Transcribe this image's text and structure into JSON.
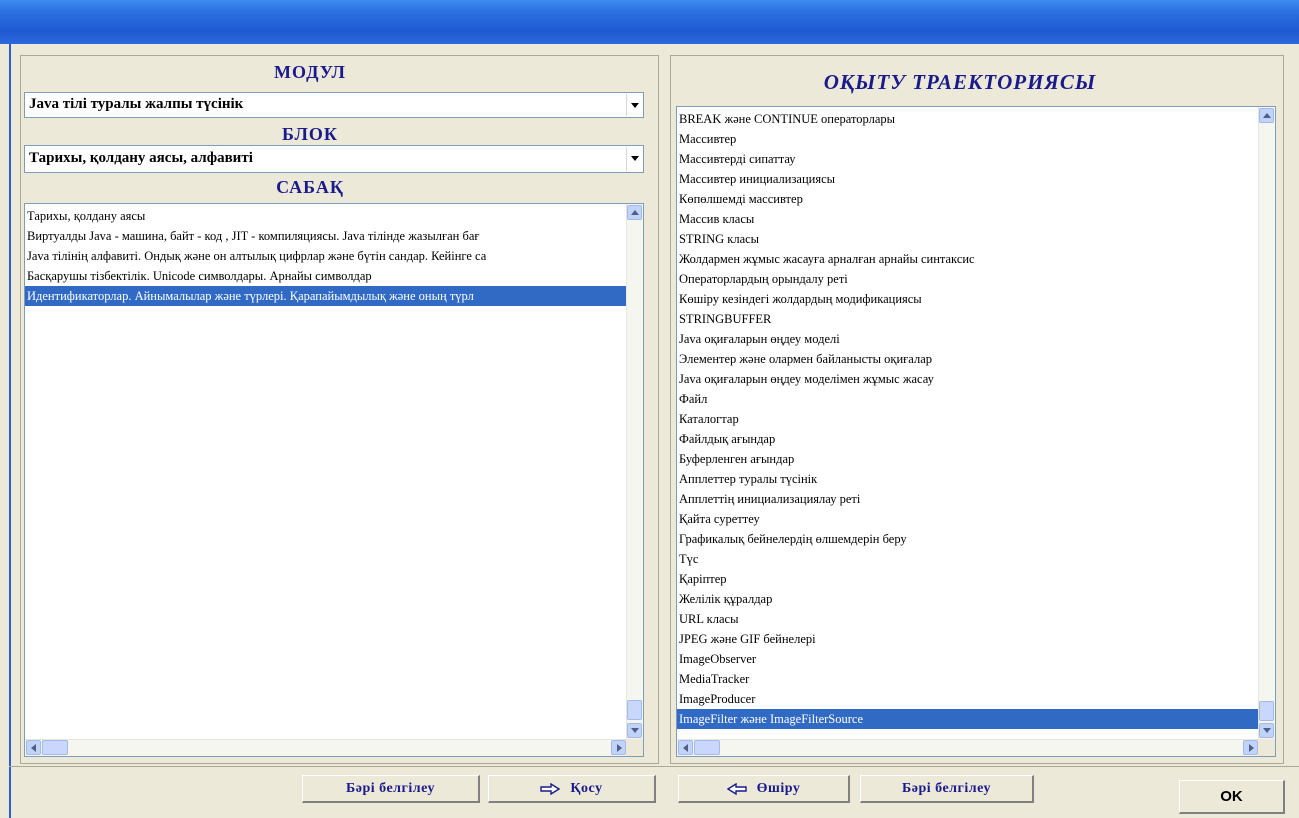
{
  "left": {
    "module_heading": "МОДУЛ",
    "module_value": "Java тілі туралы жалпы түсінік",
    "block_heading": "БЛОК",
    "block_value": "Тарихы, қолдану аясы, алфавиті",
    "lesson_heading": "САБАҚ",
    "lessons": [
      "Тарихы, қолдану аясы",
      "Виртуалды Java - машина, байт - код , JIT - компиляциясы. Java тілінде жазылған бағ",
      "Java тілінің алфавиті. Ондық және он алтылық цифрлар және бүтін сандар. Кейінге са",
      "Басқарушы тізбектілік.  Unicode символдары. Арнайы символдар",
      "Идентификаторлар. Айнымалылар және түрлері. Қарапайымдылық және оның түрл"
    ],
    "selected_lesson_index": 4
  },
  "right": {
    "heading": "ОҚЫТУ ТРАЕКТОРИЯСЫ",
    "items": [
      "BREAK және CONTINUE операторлары",
      "Массивтер",
      "Массивтерді сипаттау",
      "Массивтер инициализациясы",
      "Көпөлшемді массивтер",
      "Массив класы",
      "STRING класы",
      "Жолдармен жұмыс жасауға арналған арнайы синтаксис",
      "Операторлардың орындалу реті",
      "Көшіру кезіндегі жолдардың модификациясы",
      "STRINGBUFFER",
      "Java оқиғаларын өңдеу моделі",
      "Элементер және олармен байланысты оқиғалар",
      "Java оқиғаларын өңдеу моделімен жұмыс жасау",
      "Файл",
      "Каталогтар",
      "Файлдық ағындар",
      "Буферленген ағындар",
      "Апплеттер туралы түсінік",
      "Апплеттің инициализациялау реті",
      "Қайта суреттеу",
      "Графикалық бейнелердің өлшемдерін беру",
      "Түс",
      "Қаріптер",
      "Желілік құралдар",
      "URL класы",
      "JPEG және GIF бейнелері",
      "ImageObserver",
      "MediaTracker",
      "ImageProducer",
      "ImageFilter және ImageFilterSource"
    ],
    "selected_item_index": 30
  },
  "buttons": {
    "select_all_left": "Бәрі белгілеу",
    "add": "Қосу",
    "remove": "Өшіру",
    "select_all_right": "Бәрі белгілеу",
    "ok": "OK"
  },
  "icons": {
    "add": "arrow-right-icon",
    "remove": "arrow-left-icon"
  },
  "colors": {
    "heading": "#1a1a8c",
    "selection": "#316ac5",
    "title_bar": "#2a6ee0"
  }
}
